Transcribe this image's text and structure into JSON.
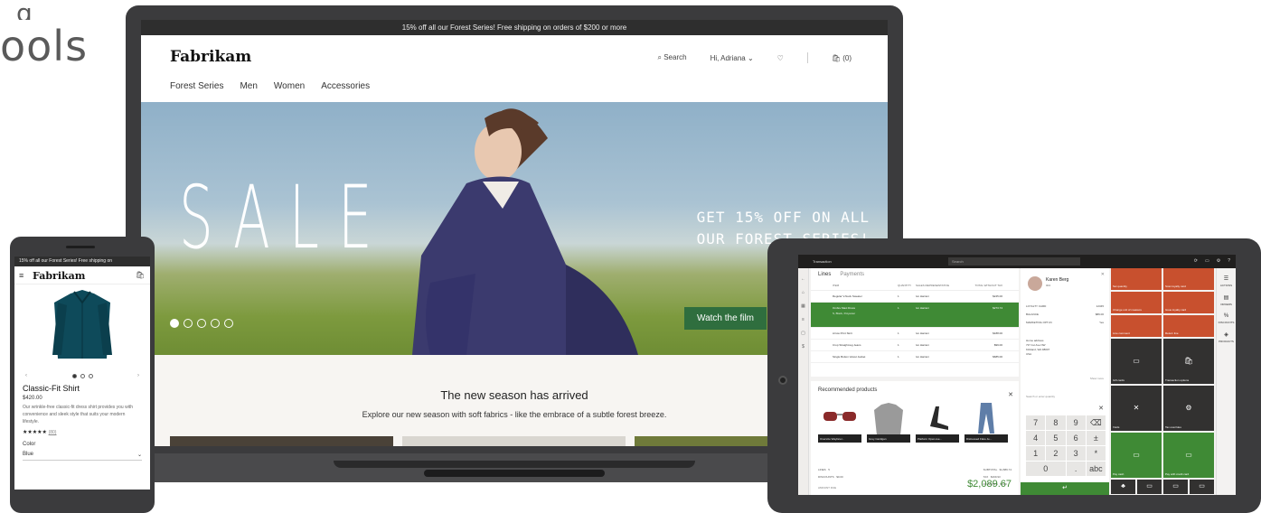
{
  "heading_fragment": {
    "partial_line": "g",
    "text": "ools"
  },
  "laptop": {
    "promo": "15% off all our Forest Series! Free shipping on orders of $200 or more",
    "logo": "Fabrikam",
    "header": {
      "search": "Search",
      "greeting": "Hi, Adriana",
      "cart": "(0)"
    },
    "nav": [
      "Forest Series",
      "Men",
      "Women",
      "Accessories"
    ],
    "hero": {
      "sale": "SALE",
      "tagline_1": "GET 15% OFF ON ALL",
      "tagline_2": "OUR FOREST SERIES!",
      "cta": "Watch the film",
      "active_slide": 1,
      "slides": 5
    },
    "season": {
      "title": "The new season has arrived",
      "subtitle": "Explore our new season with soft fabrics - like the embrace of a subtle forest breeze."
    }
  },
  "phone": {
    "promo": "15% off all our Forest Series! Free shipping on",
    "logo": "Fabrikam",
    "carousel": {
      "prev": "‹",
      "next": "›"
    },
    "product": {
      "title": "Classic-Fit Shirt",
      "price": "$420.00",
      "description": "Our wrinkle-free classic-fit dress shirt provides you with convenience and sleek style that suits your modern lifestyle.",
      "stars": "★★★★★",
      "reviews": "(80)",
      "color_label": "Color",
      "color_value": "Blue"
    }
  },
  "tablet": {
    "topbar": {
      "title": "Transaction",
      "search": "Search"
    },
    "tabs": {
      "lines": "Lines",
      "payments": "Payments"
    },
    "columns": {
      "item": "ITEM",
      "qty": "QUANTITY",
      "rep": "SALES REPRESENTATIVE",
      "total": "TOTAL WITHOUT TAX"
    },
    "rows": [
      {
        "item": "Regular V-Neck Sweater",
        "qty": "1",
        "rep": "Ivo Harrani",
        "total": "$245.00"
      },
      {
        "item": "Ombre Maxi Dress",
        "qty": "1",
        "rep": "Ivo Harrani",
        "total": "$273.74",
        "detail": "S, Black, Polyester"
      },
      {
        "item": "Arrow Print Skirt",
        "qty": "1",
        "rep": "Ivo Harrani",
        "total": "$188.00"
      },
      {
        "item": "Crop Straight-leg Jeans",
        "qty": "1",
        "rep": "Ivo Harrani",
        "total": "$99.00"
      },
      {
        "item": "Single Button Velvet Jacket",
        "qty": "1",
        "rep": "Ivo Harrani",
        "total": "$685.00"
      }
    ],
    "recommended": {
      "title": "Recommended products",
      "items": [
        "Oversize Wayfarer...",
        "Grey Cardigan",
        "Platform Open-toe...",
        "Distressed Flare Je..."
      ]
    },
    "totals": {
      "left": [
        [
          "LINES",
          "5"
        ],
        [
          "DISCOUNTS",
          "$0.00"
        ]
      ],
      "right": [
        [
          "SUBTOTAL",
          "$1,889.74"
        ],
        [
          "TAX",
          "$199.93"
        ],
        [
          "PAYMENTS",
          "$0.00"
        ]
      ],
      "due_label": "AMOUNT DUE",
      "due": "$2,089.67"
    },
    "customer": {
      "name": "Karen Berg",
      "id": "004",
      "fields": [
        [
          "LOYALTY CARD",
          "12345"
        ],
        [
          "BALANCE",
          "$89.00"
        ],
        [
          "MARKETING OPT-IN",
          "Yes"
        ]
      ],
      "address_label": "Home address",
      "address": [
        "737 1st Ave NW",
        "Kirkland, WA 98007",
        "USA"
      ],
      "more": "Show more"
    },
    "numpad": {
      "hint": "Search or enter quantity",
      "keys": [
        "7",
        "8",
        "9",
        "⌫",
        "4",
        "5",
        "6",
        "±",
        "1",
        "2",
        "3",
        "*",
        "0",
        ".",
        "abc"
      ],
      "enter": "↵"
    },
    "tiles": {
      "orange": [
        "Set quantity",
        "Scan loyalty card",
        "Change unit of measure",
        "Issue loyalty card",
        "Line comment",
        "Return line"
      ],
      "dark": [
        [
          "▭",
          "Gift cards"
        ],
        [
          "🛍",
          "Transaction options"
        ],
        [
          "✕",
          "Voids"
        ],
        [
          "⚙",
          "Tax overrides"
        ]
      ],
      "green": [
        [
          "▭",
          "Pay cash"
        ],
        [
          "▭",
          "Pay with credit card"
        ]
      ],
      "mini": [
        "♣",
        "▭",
        "▭",
        "▭"
      ]
    },
    "side": [
      [
        "☰",
        "ACTIONS"
      ],
      [
        "▤",
        "ORDERS"
      ],
      [
        "%",
        "DISCOUNTS"
      ],
      [
        "◈",
        "PRODUCTS"
      ]
    ],
    "colors": {
      "accent_green": "#3f8a35",
      "orange": "#c8502e",
      "dark": "#323130"
    }
  }
}
